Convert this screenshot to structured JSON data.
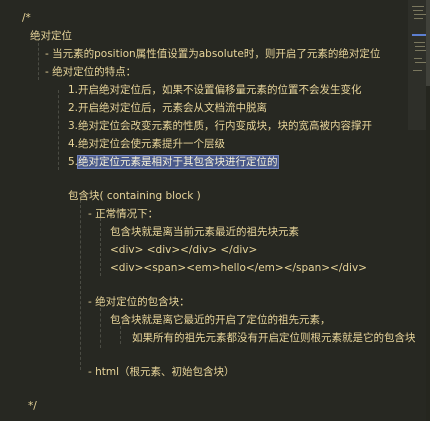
{
  "code": {
    "comment_open": "/*",
    "heading": "绝对定位",
    "item_definition": "- 当元素的position属性值设置为absolute时，则开启了元素的绝对定位",
    "item_features": "- 绝对定位的特点：",
    "features": [
      "1.开启绝对定位后，如果不设置偏移量元素的位置不会发生变化",
      "2.开启绝对定位后，元素会从文档流中脱离",
      "3.绝对定位会改变元素的性质，行内变成块，块的宽高被内容撑开",
      "4.绝对定位会使元素提升一个层级"
    ],
    "feature_5_number": "5.",
    "feature_5_selected": "绝对定位元素是相对于其包含块进行定位的",
    "containing_block_title": "包含块( containing block )",
    "normal_case": "- 正常情况下：",
    "normal_desc": "包含块就是离当前元素最近的祖先块元素",
    "example_1": "<div> <div></div> </div>",
    "example_2": "<div><span><em>hello</em></span></div>",
    "absolute_case": "- 绝对定位的包含块：",
    "absolute_desc": "包含块就是离它最近的开启了定位的祖先元素，",
    "absolute_fallback": "如果所有的祖先元素都没有开启定位则根元素就是它的包含块",
    "html_item": "- html（根元素、初始包含块）",
    "comment_close": "*/"
  },
  "colors": {
    "background": "#272822",
    "text": "#e8d59a",
    "selection": "#4a5a8c"
  }
}
